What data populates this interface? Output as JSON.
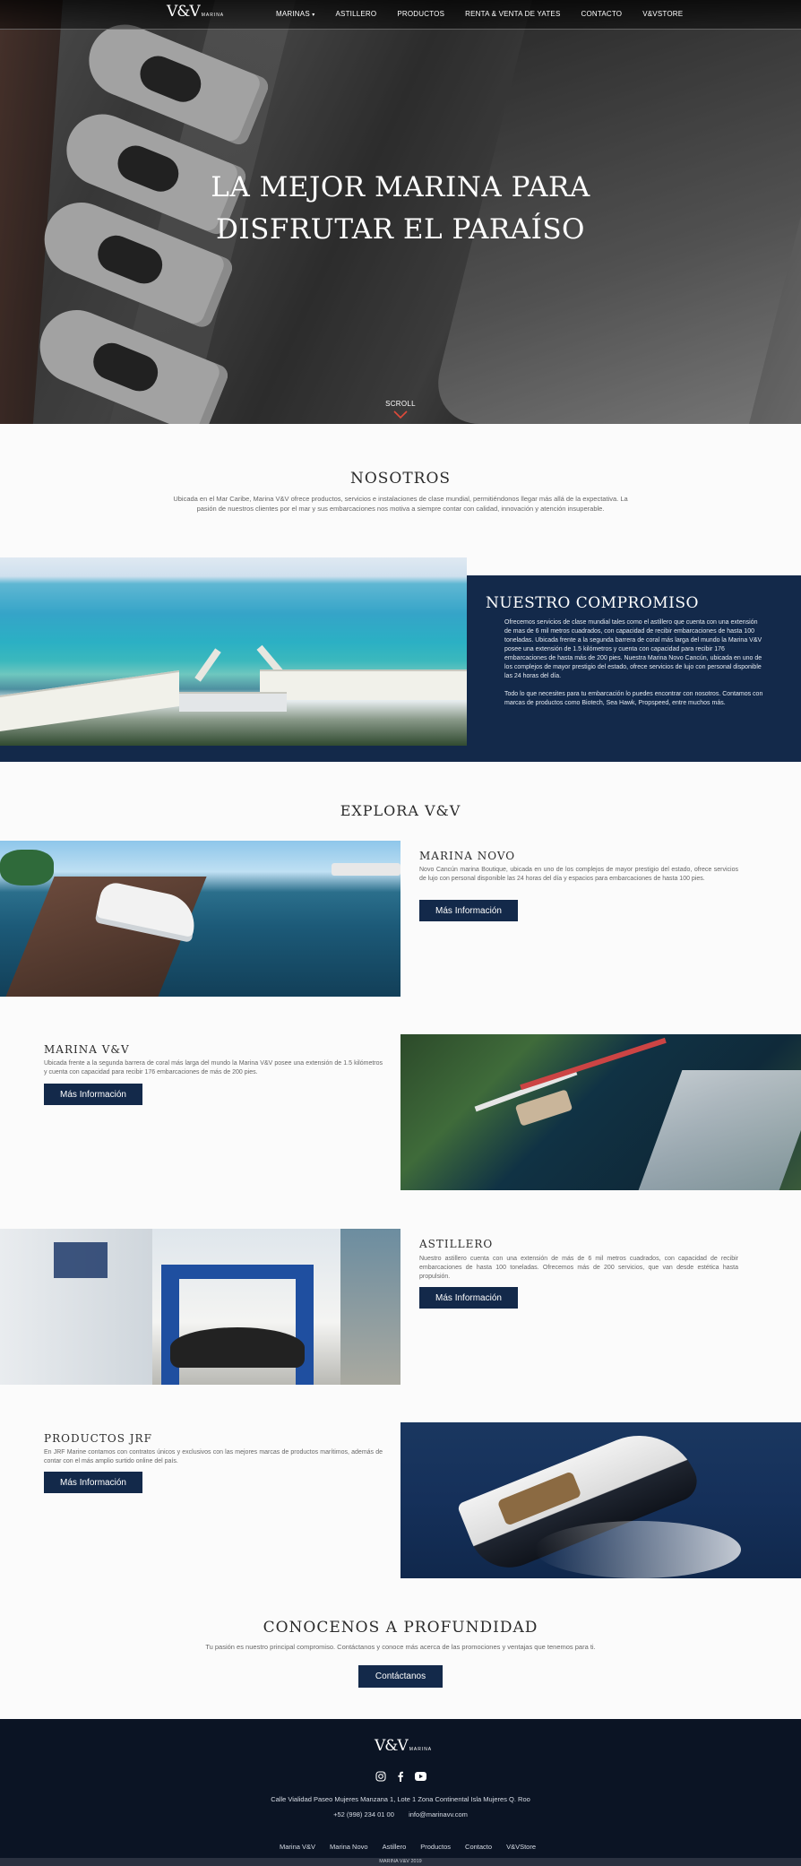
{
  "brand": {
    "logo_text": "V&V",
    "logo_sub": "MARINA"
  },
  "nav": {
    "items": [
      "MARINAS",
      "ASTILLERO",
      "PRODUCTOS",
      "RENTA & VENTA DE YATES",
      "CONTACTO",
      "V&VSTORE"
    ]
  },
  "hero": {
    "title_line1": "LA MEJOR MARINA PARA",
    "title_line2": "DISFRUTAR EL PARAÍSO",
    "scroll_label": "SCROLL"
  },
  "nosotros": {
    "title": "NOSOTROS",
    "text": "Ubicada en el Mar Caribe, Marina V&V ofrece productos, servicios e instalaciones de clase mundial, permitiéndonos llegar más allá de la expectativa. La pasión de nuestros clientes por el mar y sus embarcaciones nos motiva a siempre contar con calidad, innovación y atención insuperable."
  },
  "compromiso": {
    "title": "NUESTRO COMPROMISO",
    "paragraph1": "Ofrecemos servicios de clase mundial tales como el astillero que cuenta con una extensión de mas de 6 mil metros cuadrados, con capacidad de recibir embarcaciones de hasta 100 toneladas. Ubicada frente a la segunda barrera de coral más larga del mundo la Marina V&V posee una extensión de 1.5 kilómetros y cuenta con capacidad para recibir 176 embarcaciones de hasta más de 200 pies. Nuestra Marina Novo Cancún, ubicada en uno de los complejos de mayor prestigio del estado, ofrece servicios de lujo con personal disponible las 24 horas del día.",
    "paragraph2": "Todo lo que necesites para tu embarcación lo puedes encontrar con nosotros. Contamos con marcas de productos como Biotech, Sea Hawk, Propspeed, entre muchos más."
  },
  "explora": {
    "title": "EXPLORA V&V",
    "features": [
      {
        "title": "MARINA NOVO",
        "text": "Novo Cancún marina Boutique, ubicada en uno de los complejos de mayor prestigio del estado, ofrece servicios de lujo con personal disponible las 24 horas del día y espacios para embarcaciones de hasta 100 pies.",
        "button": "Más Información"
      },
      {
        "title": "MARINA V&V",
        "text": "Ubicada frente a la segunda barrera de coral más larga del mundo la Marina V&V posee una extensión de 1.5 kilómetros y cuenta con capacidad para recibir 176 embarcaciones de más de 200 pies.",
        "button": "Más Información"
      },
      {
        "title": "ASTILLERO",
        "text": "Nuestro astillero cuenta con una extensión de más de 6 mil metros cuadrados, con capacidad de recibir embarcaciones de hasta 100 toneladas. Ofrecemos más de 200 servicios, que van desde estética hasta propulsión.",
        "button": "Más Información"
      },
      {
        "title": "PRODUCTOS JRF",
        "text": "En JRF Marine contamos con contratos únicos y exclusivos con las mejores marcas de productos marítimos, además de contar con el más amplio surtido online del país.",
        "button": "Más Información"
      }
    ]
  },
  "conocenos": {
    "title": "CONOCENOS A PROFUNDIDAD",
    "text": "Tu pasión es nuestro principal compromiso. Contáctanos y conoce más acerca de las promociones y ventajas que tenemos para ti.",
    "button": "Contáctanos"
  },
  "footer": {
    "address": "Calle Vialidad Paseo Mujeres Manzana 1, Lote 1 Zona Continental Isla Mujeres Q. Roo",
    "phone": "+52 (998) 234 01 00",
    "email": "info@marinavv.com",
    "links": [
      "Marina V&V",
      "Marina Novo",
      "Astillero",
      "Productos",
      "Contacto",
      "V&VStore"
    ],
    "copyright": "MARINA V&V 2019",
    "icons": [
      "instagram-icon",
      "facebook-icon",
      "youtube-icon"
    ]
  },
  "colors": {
    "navy": "#13294a",
    "footer": "#0b1424",
    "accent_red": "#c0392b"
  }
}
